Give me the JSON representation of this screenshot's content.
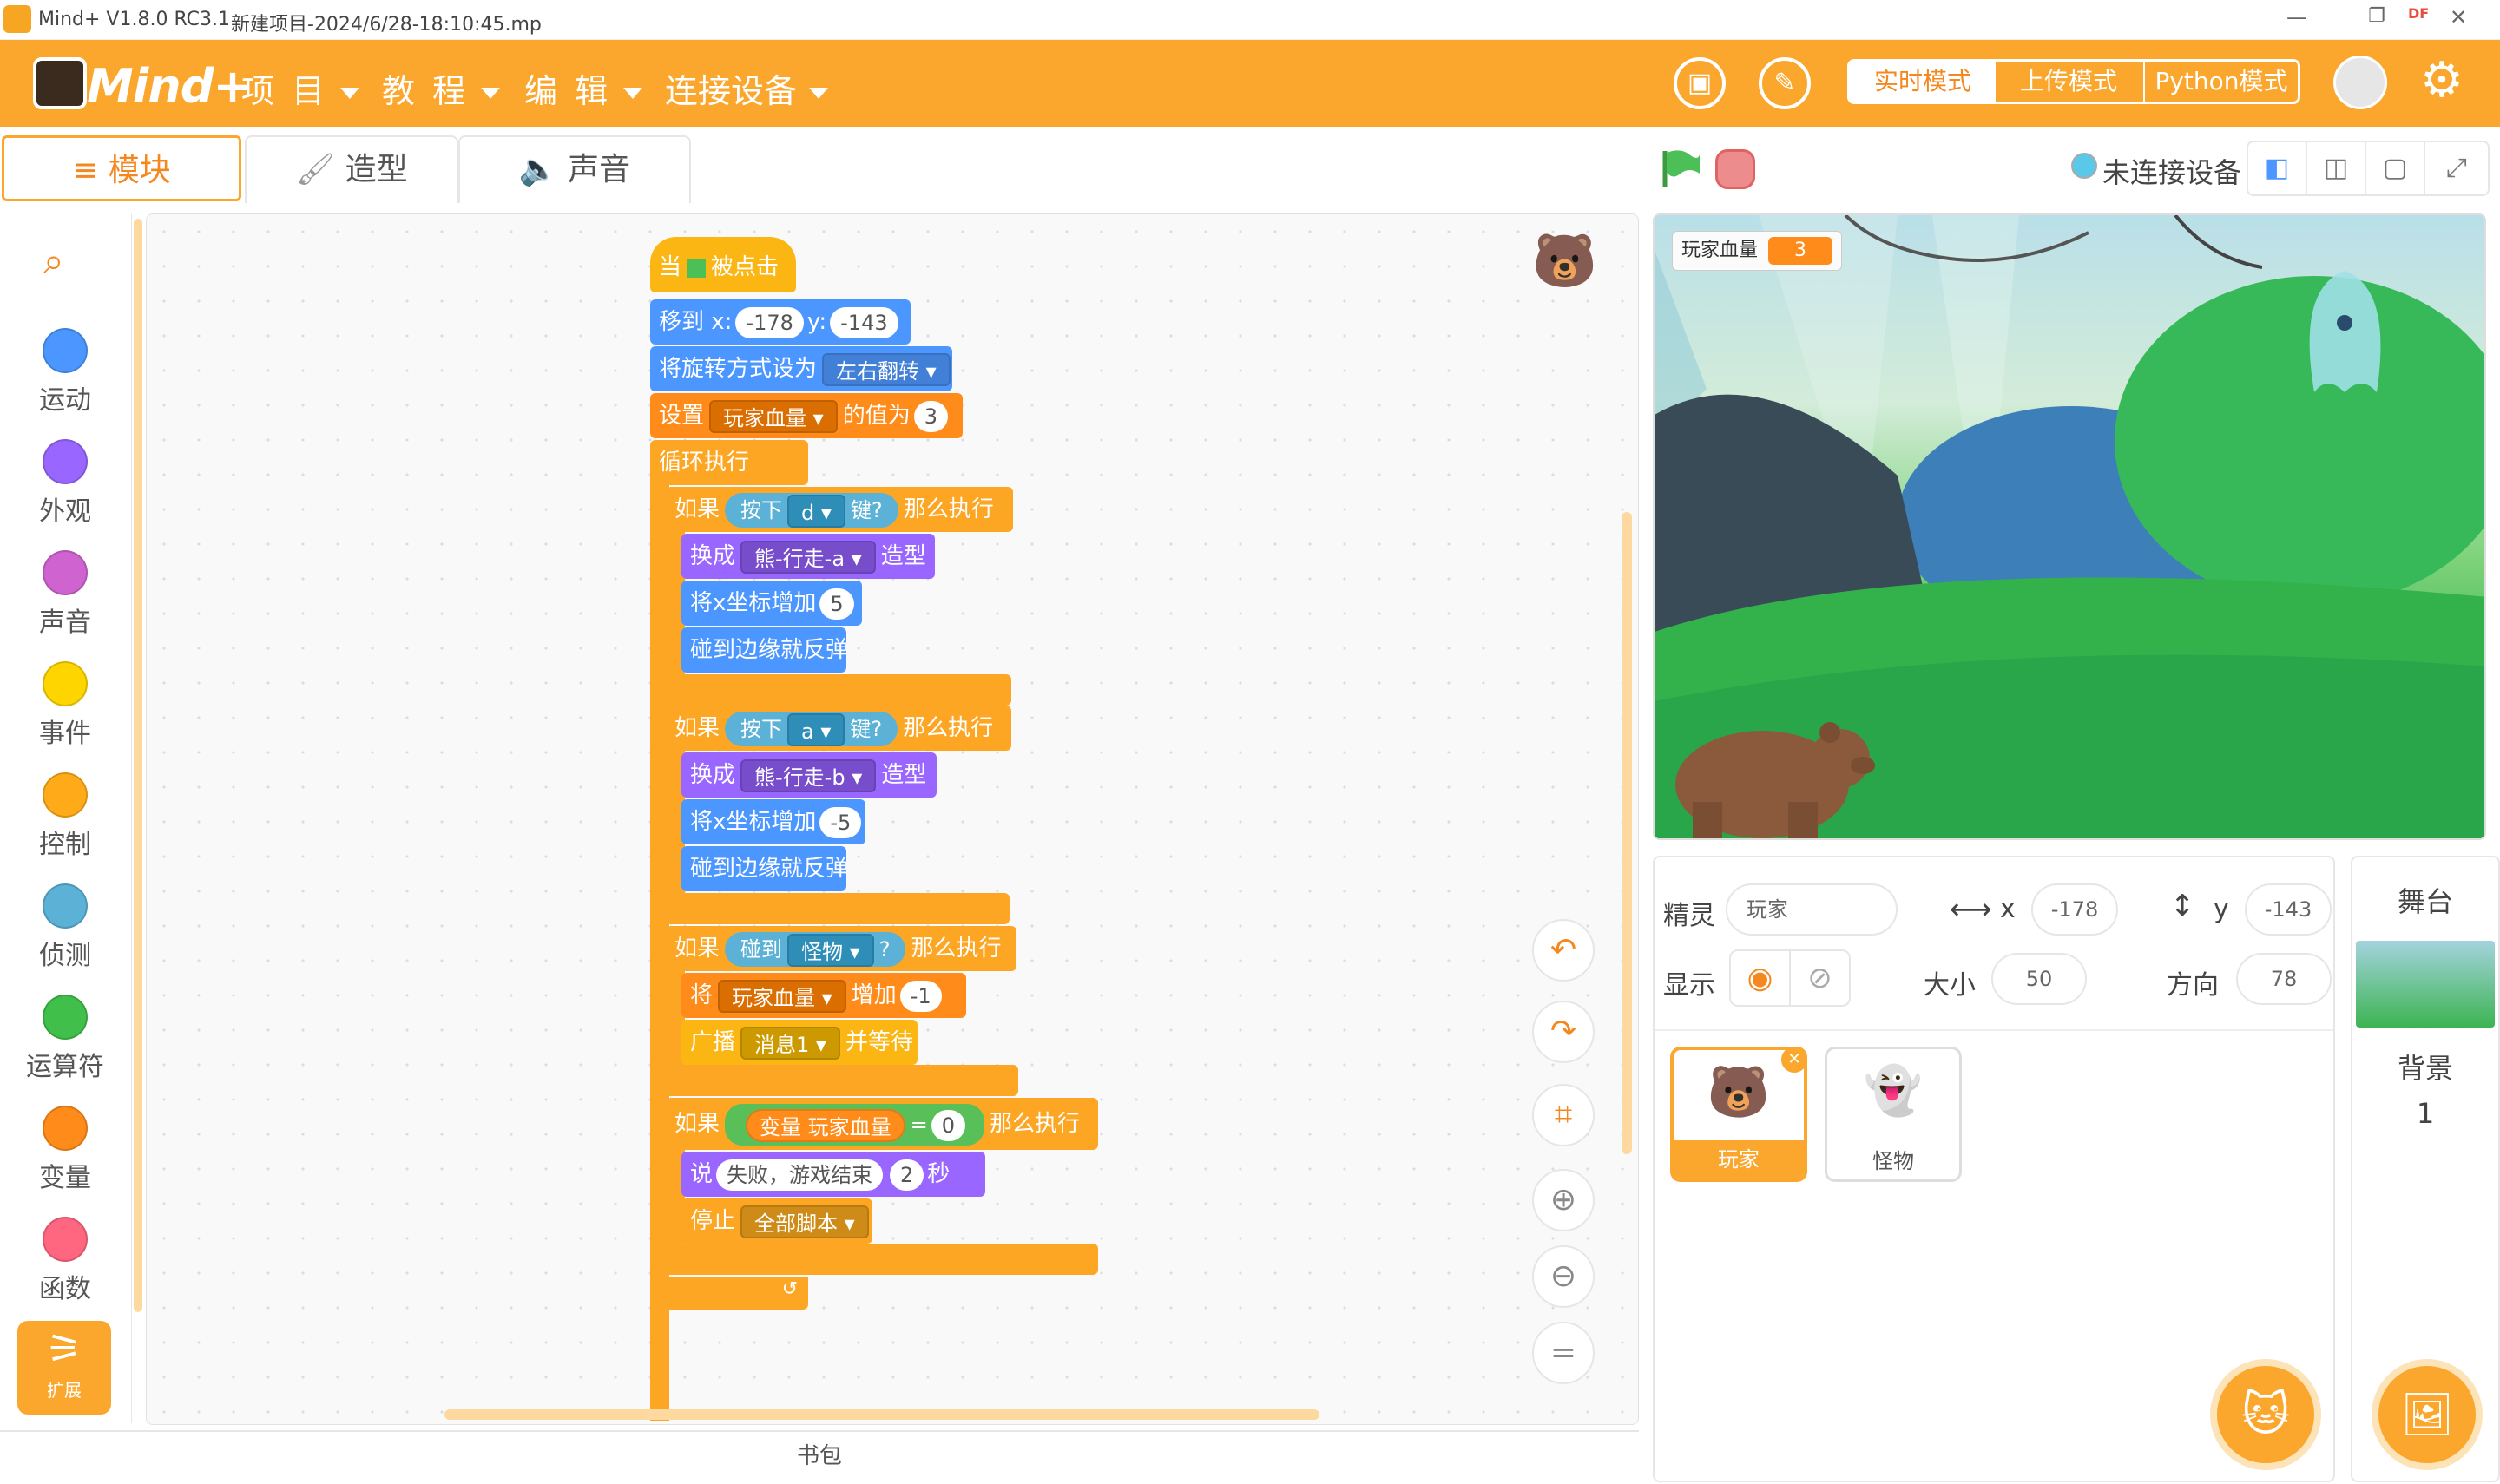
{
  "window": {
    "title": "Mind+ V1.8.0 RC3.1",
    "project": "新建项目-2024/6/28-18:10:45.mp",
    "badge": "DF"
  },
  "menu": {
    "logo": "Mind+",
    "items": [
      "项 目",
      "教 程",
      "编 辑",
      "连接设备"
    ],
    "modes": [
      "实时模式",
      "上传模式",
      "Python模式"
    ],
    "active_mode": "实时模式"
  },
  "tabs": [
    "模块",
    "造型",
    "声音"
  ],
  "categories": [
    {
      "label": "运动",
      "color": "#4c97ff"
    },
    {
      "label": "外观",
      "color": "#9966ff"
    },
    {
      "label": "声音",
      "color": "#cf63cf"
    },
    {
      "label": "事件",
      "color": "#ffd500"
    },
    {
      "label": "控制",
      "color": "#ffab19"
    },
    {
      "label": "侦测",
      "color": "#5cb1d6"
    },
    {
      "label": "运算符",
      "color": "#40bf4a"
    },
    {
      "label": "变量",
      "color": "#ff8c1a"
    },
    {
      "label": "函数",
      "color": "#ff6680"
    }
  ],
  "extension_label": "扩展",
  "bookbag": "书包",
  "script": {
    "when": "当",
    "clicked": "被点击",
    "goto": "移到 x:",
    "x": "-178",
    "y_label": "y:",
    "y": "-143",
    "rotation": "将旋转方式设为",
    "rotation_value": "左右翻转",
    "set": "设置",
    "var": "玩家血量",
    "value_of": "的值为",
    "set_value": "3",
    "forever": "循环执行",
    "if": "如果",
    "then": "那么执行",
    "key_pressed": "按下",
    "key_q": "键?",
    "key_d": "d",
    "key_a": "a",
    "switch": "换成",
    "costume_a": "熊-行走-a",
    "costume_b": "熊-行走-b",
    "costume": "造型",
    "change_x": "将x坐标增加",
    "dx1": "5",
    "dx2": "-5",
    "bounce": "碰到边缘就反弹",
    "touching": "碰到",
    "monster": "怪物",
    "qmark": "?",
    "change": "将",
    "add": "增加",
    "change_value": "-1",
    "broadcast": "广播",
    "message": "消息1",
    "wait": "并等待",
    "variable": "变量",
    "eq": "=",
    "zero": "0",
    "say": "说",
    "say_text": "失败，游戏结束",
    "say_secs": "2",
    "secs": "秒",
    "stop": "停止",
    "stop_value": "全部脚本"
  },
  "stage_bar": {
    "device_status": "未连接设备"
  },
  "monitor": {
    "label": "玩家血量",
    "value": "3"
  },
  "sprite_info": {
    "sprite_label": "精灵",
    "sprite_name": "玩家",
    "x_label": "x",
    "x": "-178",
    "y_label": "y",
    "y": "-143",
    "show_label": "显示",
    "size_label": "大小",
    "size": "50",
    "direction_label": "方向",
    "direction": "78"
  },
  "sprites": [
    {
      "name": "玩家",
      "selected": true
    },
    {
      "name": "怪物",
      "selected": false
    }
  ],
  "stage_panel": {
    "title": "舞台",
    "backdrop_label": "背景",
    "backdrop_count": "1"
  },
  "colors": {
    "accent": "#fba62c",
    "orange_text": "#f5871f"
  }
}
